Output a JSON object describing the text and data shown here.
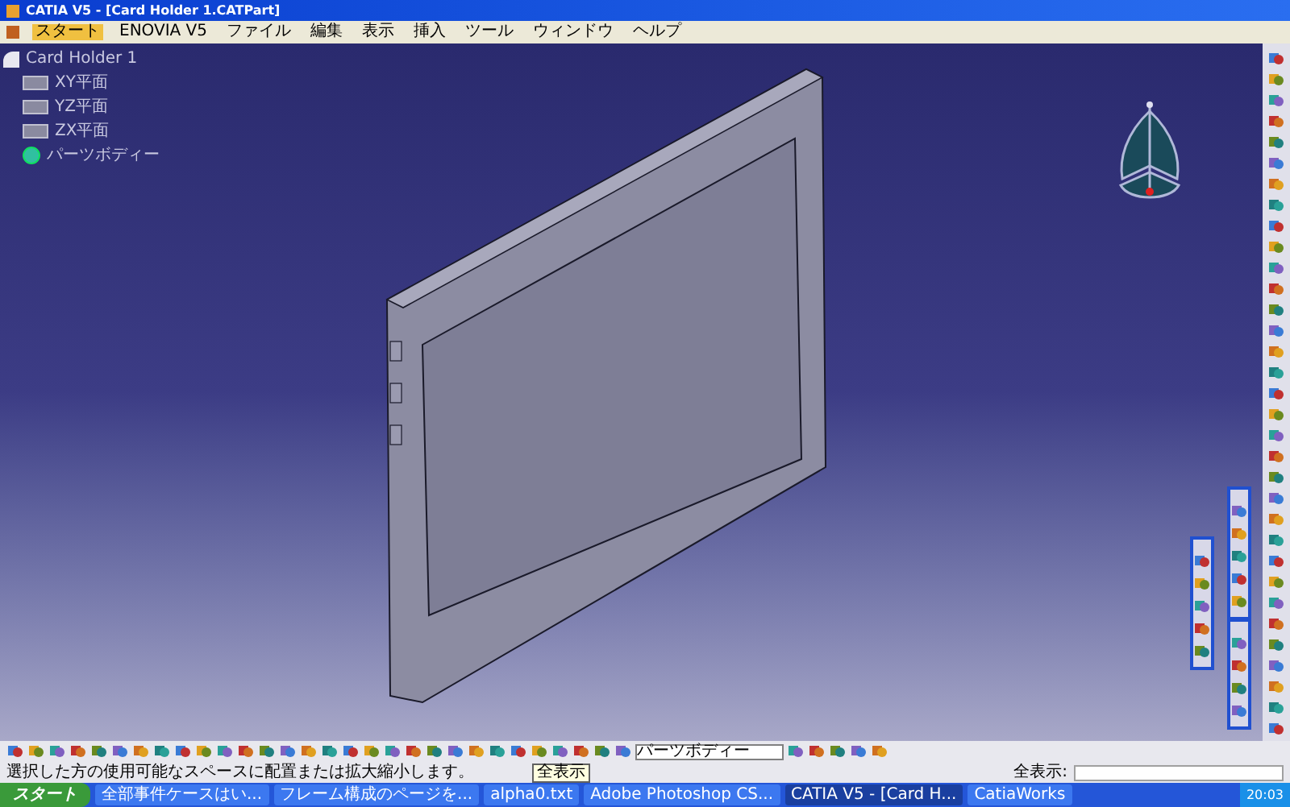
{
  "window": {
    "title": "CATIA V5 - [Card Holder 1.CATPart]"
  },
  "menu": [
    {
      "label": "スタート",
      "selected": true
    },
    {
      "label": "ENOVIA V5",
      "selected": false
    },
    {
      "label": "ファイル",
      "selected": false
    },
    {
      "label": "編集",
      "selected": false
    },
    {
      "label": "表示",
      "selected": false
    },
    {
      "label": "挿入",
      "selected": false
    },
    {
      "label": "ツール",
      "selected": false
    },
    {
      "label": "ウィンドウ",
      "selected": false
    },
    {
      "label": "ヘルプ",
      "selected": false
    }
  ],
  "tree": {
    "label": "Card Holder 1",
    "children": [
      {
        "label": "XY平面",
        "kind": "plane"
      },
      {
        "label": "YZ平面",
        "kind": "plane"
      },
      {
        "label": "ZX平面",
        "kind": "plane"
      },
      {
        "label": "パーツボディー",
        "kind": "body"
      }
    ]
  },
  "toolbar": {
    "body_select": {
      "value": "パーツボディー"
    }
  },
  "status_bar": {
    "message": "選択した方の使用可能なスペースに配置または拡大縮小します。",
    "tooltip": "全表示",
    "command_label": "全表示:"
  },
  "taskbar": {
    "start": "スタート",
    "items": [
      {
        "label": "全部事件ケースはい...",
        "selected": false
      },
      {
        "label": "フレーム構成のページを...",
        "selected": false
      },
      {
        "label": "alpha0.txt",
        "selected": false
      },
      {
        "label": "Adobe Photoshop CS...",
        "selected": false
      },
      {
        "label": "CATIA V5 - [Card H...",
        "selected": true
      },
      {
        "label": "CatiaWorks",
        "selected": false
      }
    ],
    "clock": "20:03"
  }
}
